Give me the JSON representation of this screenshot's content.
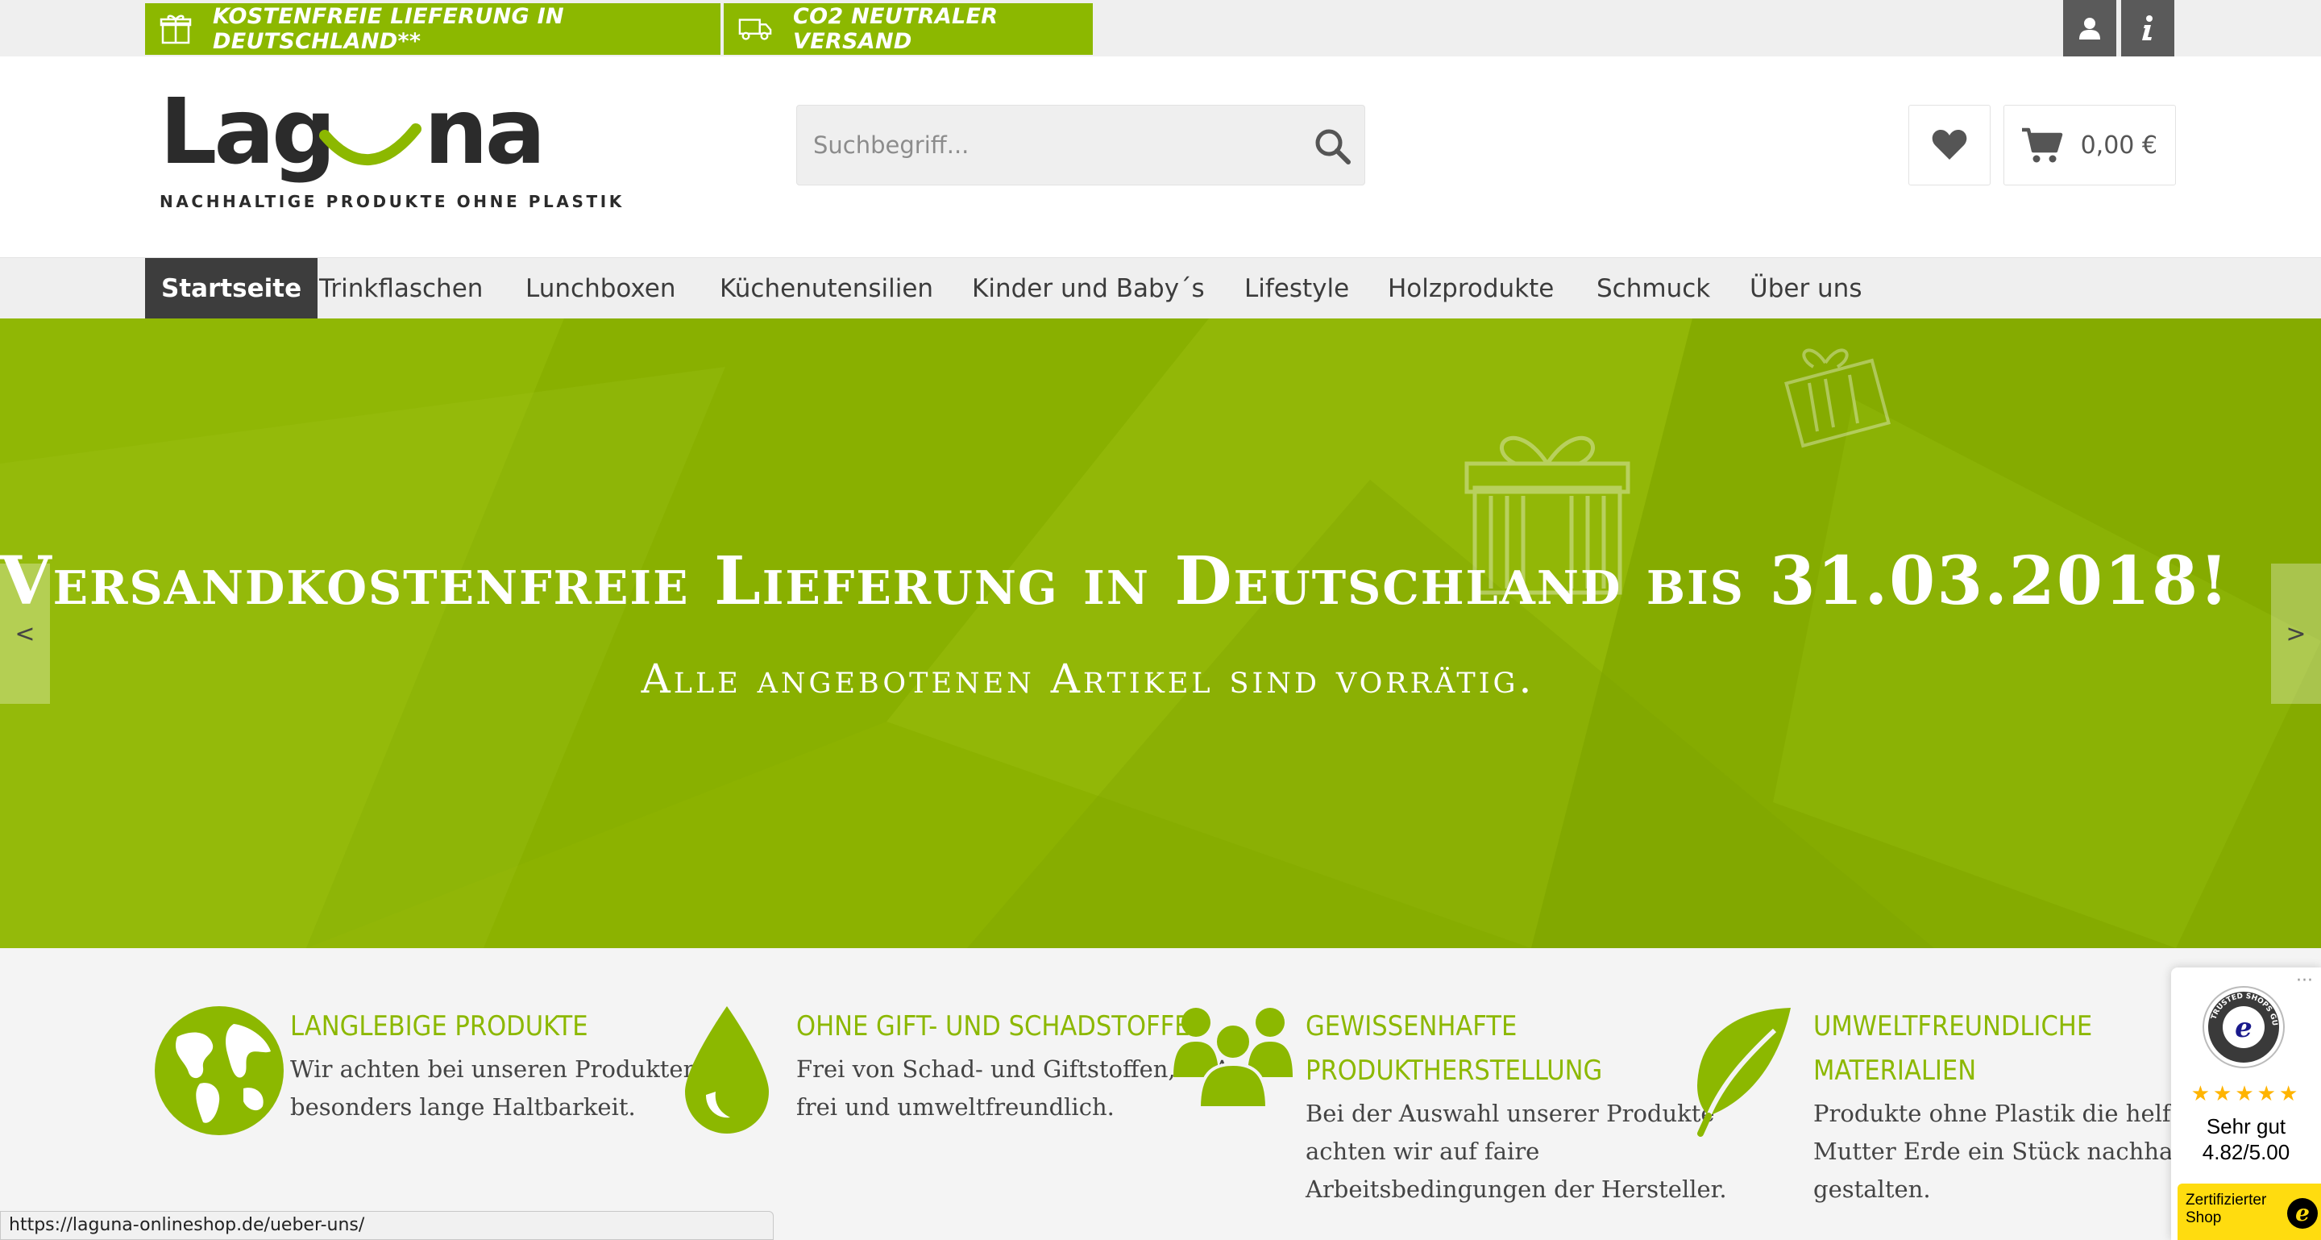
{
  "topbar": {
    "badges": [
      {
        "label": "KOSTENFREIE LIEFERUNG IN DEUTSCHLAND**",
        "icon": "gift-box-icon"
      },
      {
        "label": "CO2 NEUTRALER VERSAND",
        "icon": "truck-icon"
      }
    ],
    "account_icon": "user-icon",
    "info_icon": "info-icon"
  },
  "logo": {
    "word": "Lag na",
    "tagline": "NACHHALTIGE PRODUKTE OHNE PLASTIK"
  },
  "search": {
    "placeholder": "Suchbegriff...",
    "icon": "search-icon"
  },
  "header": {
    "wishlist_icon": "heart-icon",
    "cart_icon": "cart-icon",
    "cart_amount": "0,00 €"
  },
  "nav": {
    "items": [
      {
        "label": "Startseite",
        "active": true
      },
      {
        "label": "Trinkflaschen"
      },
      {
        "label": "Lunchboxen"
      },
      {
        "label": "Küchenutensilien"
      },
      {
        "label": "Kinder und Baby´s"
      },
      {
        "label": "Lifestyle"
      },
      {
        "label": "Holzprodukte"
      },
      {
        "label": "Schmuck"
      },
      {
        "label": "Über uns"
      }
    ]
  },
  "hero": {
    "headline": "Versandkostenfreie Lieferung in Deutschland bis 31.03.2018!",
    "subline": "Alle angebotenen Artikel sind vorrätig.",
    "prev": "<",
    "next": ">"
  },
  "features": [
    {
      "icon": "globe-icon",
      "title_lines": [
        "LANGLEBIGE PRODUKTE"
      ],
      "text_lines": [
        "Wir achten bei unseren Produkten auf",
        "besonders lange Haltbarkeit."
      ]
    },
    {
      "icon": "water-drop-icon",
      "title_lines": [
        "OHNE GIFT- UND SCHADSTOFFE"
      ],
      "text_lines": [
        "Frei von Schad- und Giftstoffen, BPA-",
        "frei und umweltfreundlich."
      ]
    },
    {
      "icon": "people-group-icon",
      "title_lines": [
        "GEWISSENHAFTE",
        "PRODUKTHERSTELLUNG"
      ],
      "text_lines": [
        "Bei der Auswahl unserer Produkte",
        "achten wir auf faire",
        "Arbeitsbedingungen der Hersteller."
      ]
    },
    {
      "icon": "leaf-icon",
      "title_lines": [
        "UMWELTFREUNDLICHE",
        "MATERIALIEN"
      ],
      "text_lines": [
        "Produkte ohne Plastik die helfen",
        "Mutter Erde ein Stück nachhaltiger zu",
        "gestalten."
      ]
    }
  ],
  "trusted_shops": {
    "seal_text": "TRUSTED SHOPS GUARANTEE",
    "stars": "★★★★★",
    "rating_label": "Sehr gut",
    "score": "4.82/5.00",
    "certified_label": "Zertifizierter Shop",
    "more": "···"
  },
  "statusbar": {
    "url": "https://laguna-onlineshop.de/ueber-uns/"
  },
  "colors": {
    "brand_green": "#8cb800",
    "nav_active": "#3d3d3d",
    "hero_bg": "#8cb200",
    "trusted_yellow": "#ffdc0f"
  }
}
